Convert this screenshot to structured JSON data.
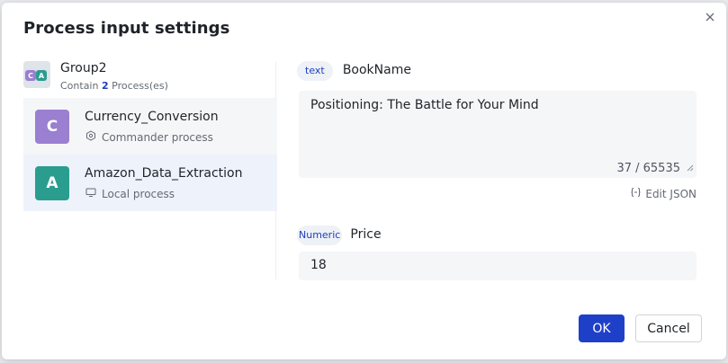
{
  "dialog": {
    "title": "Process input settings",
    "ok_label": "OK",
    "cancel_label": "Cancel"
  },
  "group": {
    "name": "Group2",
    "sub_prefix": "Contain",
    "count": "2",
    "sub_suffix": "Process(es)",
    "icon_letters": [
      "C",
      "A"
    ]
  },
  "processes": [
    {
      "avatar": "C",
      "name": "Currency_Conversion",
      "type": "Commander process",
      "color": "#9b7fd0",
      "icon": "commander-icon"
    },
    {
      "avatar": "A",
      "name": "Amazon_Data_Extraction",
      "type": "Local process",
      "color": "#2a9d8f",
      "icon": "monitor-icon",
      "selected": true
    }
  ],
  "params": [
    {
      "tag": "text",
      "label": "BookName",
      "value": "Positioning: The Battle for Your Mind",
      "counter": "37 / 65535",
      "edit_json": "Edit JSON"
    },
    {
      "tag": "Numeric",
      "label": "Price",
      "value": "18"
    }
  ]
}
